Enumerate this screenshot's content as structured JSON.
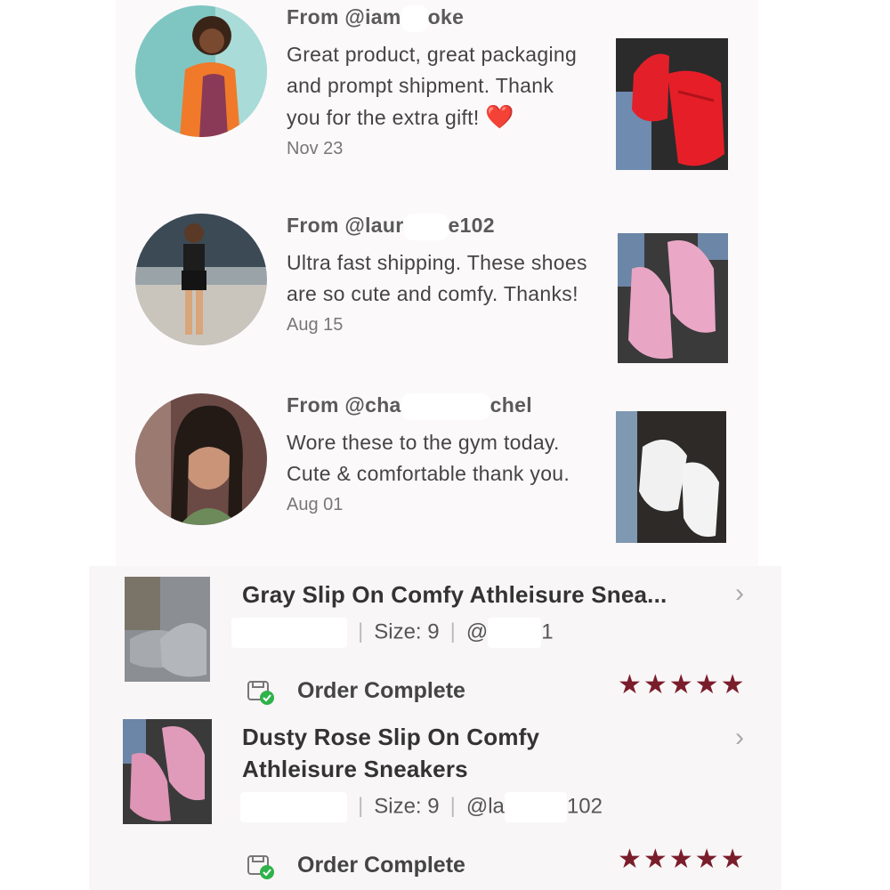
{
  "reviews": [
    {
      "from": "From @iam",
      "from_tail": "oke",
      "text": "Great product, great packaging and prompt shipment. Thank you for the extra gift!",
      "emoji": "❤️",
      "date": "Nov 23",
      "photo_color": "red"
    },
    {
      "from": "From @laur",
      "from_tail": "e102",
      "text": "Ultra fast shipping. These shoes are so cute and comfy. Thanks!",
      "emoji": "",
      "date": "Aug 15",
      "photo_color": "pink"
    },
    {
      "from": "From @cha",
      "from_tail": "chel",
      "text": "Wore these to the gym today. Cute & comfortable thank you.",
      "emoji": "",
      "date": "Aug 01",
      "photo_color": "white"
    }
  ],
  "orders": [
    {
      "title": "Gray Slip On Comfy Athleisure Snea...",
      "size": "Size: 9",
      "user": "@",
      "user_tail": "1",
      "status": "Order Complete",
      "stars": "★★★★★",
      "colors": {
        "shoe": "#9b9fa6"
      }
    },
    {
      "title_line1": "Dusty Rose Slip On Comfy",
      "title_line2": "Athleisure Sneakers",
      "size": "Size: 9",
      "user": "@la",
      "user_tail": "102",
      "status": "Order Complete",
      "stars": "★★★★★",
      "colors": {
        "shoe": "#d98fae"
      }
    }
  ],
  "icons": {
    "chevron": "chevron-right-icon",
    "status": "package-check-icon"
  },
  "colors": {
    "star": "#7a1d2b",
    "heart": "#e3171f",
    "panel": "#fcf9fa"
  }
}
